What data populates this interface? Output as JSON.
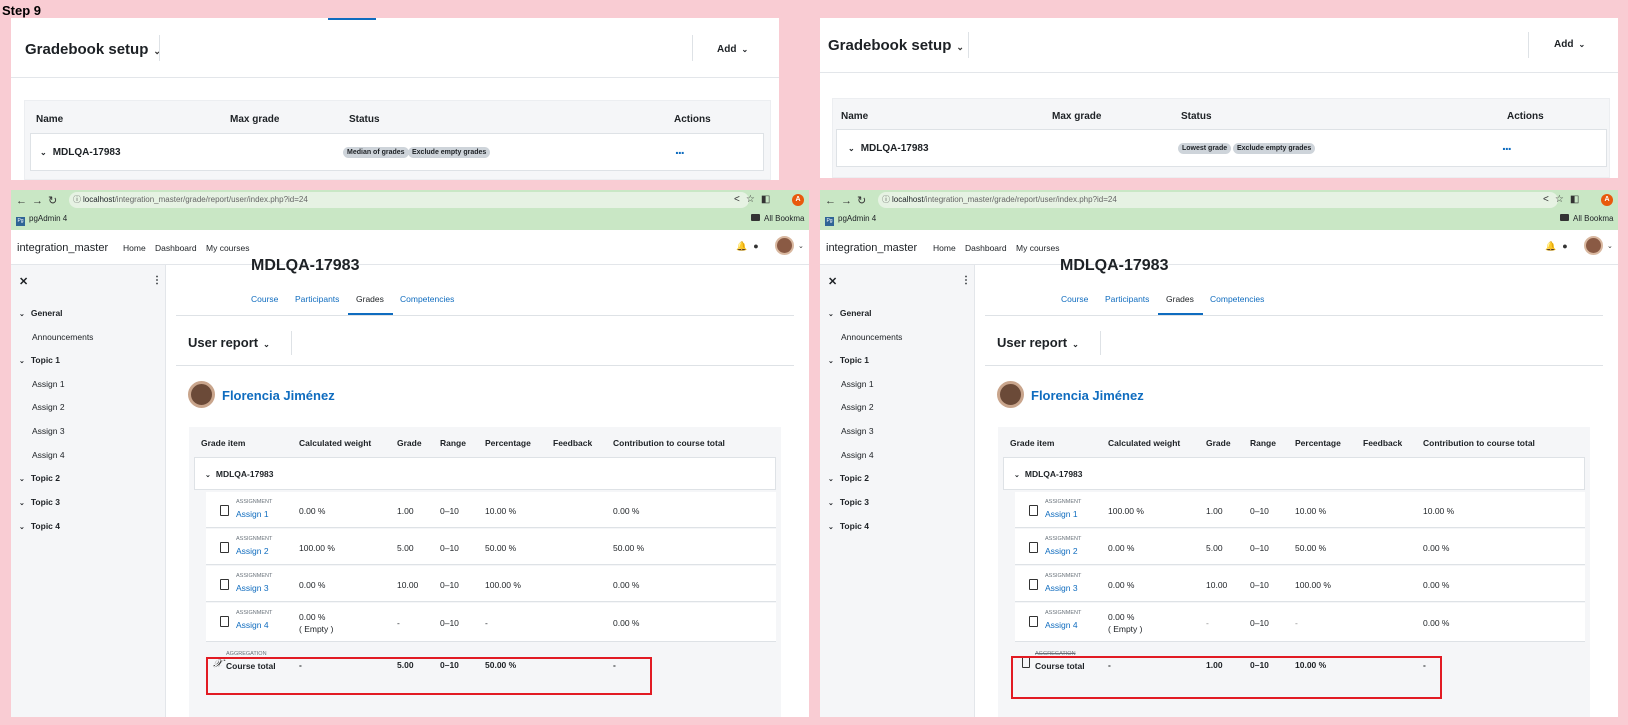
{
  "step_label": "Step 9",
  "gradebook": {
    "title": "Gradebook setup",
    "add_label": "Add",
    "columns": {
      "name": "Name",
      "max_grade": "Max grade",
      "status": "Status",
      "actions": "Actions"
    },
    "category": "MDLQA-17983",
    "actions_glyph": "...",
    "left_badges": [
      "Median of grades",
      "Exclude empty grades"
    ],
    "right_badges": [
      "Lowest grade",
      "Exclude empty grades"
    ]
  },
  "browser": {
    "url_host": "localhost",
    "url_path": "/integration_master/grade/report/user/index.php?id=24",
    "bookmark_pgadmin": "pgAdmin 4",
    "bookmark_all": "All Bookma",
    "profile_initial": "A"
  },
  "site": {
    "name": "integration_master",
    "nav": [
      "Home",
      "Dashboard",
      "My courses"
    ]
  },
  "drawer": {
    "close": "✕",
    "kebab": "⋮",
    "general": "General",
    "announcements": "Announcements",
    "topic1": "Topic 1",
    "assign1": "Assign 1",
    "assign2": "Assign 2",
    "assign3": "Assign 3",
    "assign4": "Assign 4",
    "topic2": "Topic 2",
    "topic3": "Topic 3",
    "topic4": "Topic 4"
  },
  "course": {
    "heading": "MDLQA-17983",
    "tabs": [
      "Course",
      "Participants",
      "Grades",
      "Competencies"
    ],
    "report_title": "User report",
    "student_name": "Florencia Jiménez"
  },
  "user_report": {
    "columns": {
      "grade_item": "Grade item",
      "calc_weight": "Calculated weight",
      "grade": "Grade",
      "range": "Range",
      "percentage": "Percentage",
      "feedback": "Feedback",
      "contribution": "Contribution to course total"
    },
    "category": "MDLQA-17983",
    "assignment_label": "ASSIGNMENT",
    "aggregation_label": "AGGREGATION",
    "course_total_label": "Course total",
    "empty_note": "( Empty )",
    "left": {
      "rows": [
        {
          "name": "Assign 1",
          "weight": "0.00 %",
          "grade": "1.00",
          "range": "0–10",
          "pct": "10.00 %",
          "contrib": "0.00 %"
        },
        {
          "name": "Assign 2",
          "weight": "100.00 %",
          "grade": "5.00",
          "range": "0–10",
          "pct": "50.00 %",
          "contrib": "50.00 %"
        },
        {
          "name": "Assign 3",
          "weight": "0.00 %",
          "grade": "10.00",
          "range": "0–10",
          "pct": "100.00 %",
          "contrib": "0.00 %"
        },
        {
          "name": "Assign 4",
          "weight": "0.00 %",
          "grade": "-",
          "range": "0–10",
          "pct": "-",
          "contrib": "0.00 %"
        }
      ],
      "total": {
        "weight": "-",
        "grade": "5.00",
        "range": "0–10",
        "pct": "50.00 %",
        "contrib": "-"
      }
    },
    "right": {
      "rows": [
        {
          "name": "Assign 1",
          "weight": "100.00 %",
          "grade": "1.00",
          "range": "0–10",
          "pct": "10.00 %",
          "contrib": "10.00 %"
        },
        {
          "name": "Assign 2",
          "weight": "0.00 %",
          "grade": "5.00",
          "range": "0–10",
          "pct": "50.00 %",
          "contrib": "0.00 %"
        },
        {
          "name": "Assign 3",
          "weight": "0.00 %",
          "grade": "10.00",
          "range": "0–10",
          "pct": "100.00 %",
          "contrib": "0.00 %"
        },
        {
          "name": "Assign 4",
          "weight": "0.00 %",
          "grade": "-",
          "range": "0–10",
          "pct": "-",
          "contrib": "0.00 %"
        }
      ],
      "total": {
        "weight": "-",
        "grade": "1.00",
        "range": "0–10",
        "pct": "10.00 %",
        "contrib": "-"
      }
    }
  },
  "colors": {
    "accent": "#0f6cbf",
    "highlight": "#e21b23",
    "background": "#f9ccd3",
    "chrome": "#c9e7c5"
  }
}
